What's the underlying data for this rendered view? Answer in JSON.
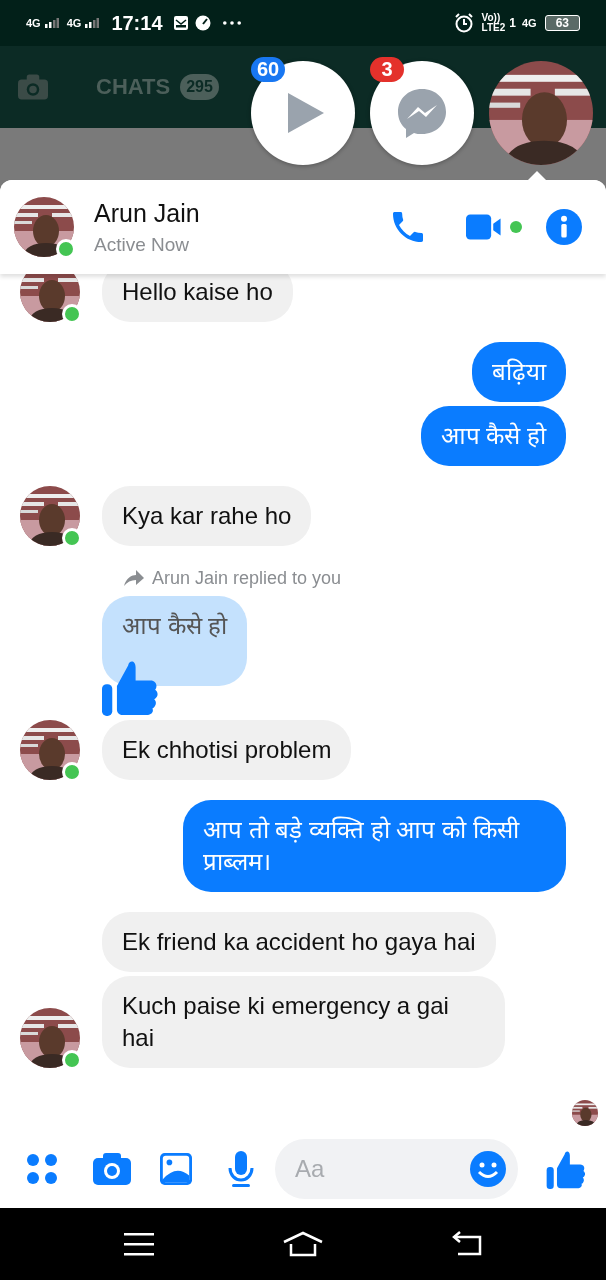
{
  "status_bar": {
    "network_1": "4G",
    "network_2": "4G",
    "time": "17:14",
    "volte": "Vo))",
    "sim": "1",
    "lte": "LTE2",
    "network_3": "4G",
    "battery": "63"
  },
  "background_app": {
    "tab": "CHATS",
    "badge": "295"
  },
  "chat_heads": [
    {
      "kind": "video",
      "badge": "60",
      "color": "#1877f2"
    },
    {
      "kind": "messenger",
      "badge": "3",
      "color": "#e4312b"
    },
    {
      "kind": "avatar"
    }
  ],
  "conversation": {
    "name": "Arun Jain",
    "status": "Active Now",
    "online": true
  },
  "messages": [
    {
      "kind": "incoming",
      "text": "Hello kaise ho"
    },
    {
      "kind": "outgoing",
      "text": "बढ़िया"
    },
    {
      "kind": "outgoing",
      "text": "आप कैसे हो"
    },
    {
      "kind": "incoming",
      "text": "Kya kar rahe ho"
    },
    {
      "kind": "note",
      "text": "Arun Jain replied to you"
    },
    {
      "kind": "reply",
      "text": "आप कैसे हो"
    },
    {
      "kind": "incoming",
      "text": "Ek chhotisi problem"
    },
    {
      "kind": "outgoing",
      "text": "आप तो बड़े व्यक्ति हो आप को किसी प्राब्लम।"
    },
    {
      "kind": "incoming",
      "text": "Ek friend ka accident ho gaya hai"
    },
    {
      "kind": "incoming",
      "text": "Kuch paise ki emergency a gai hai"
    }
  ],
  "composer": {
    "placeholder": "Aa"
  }
}
